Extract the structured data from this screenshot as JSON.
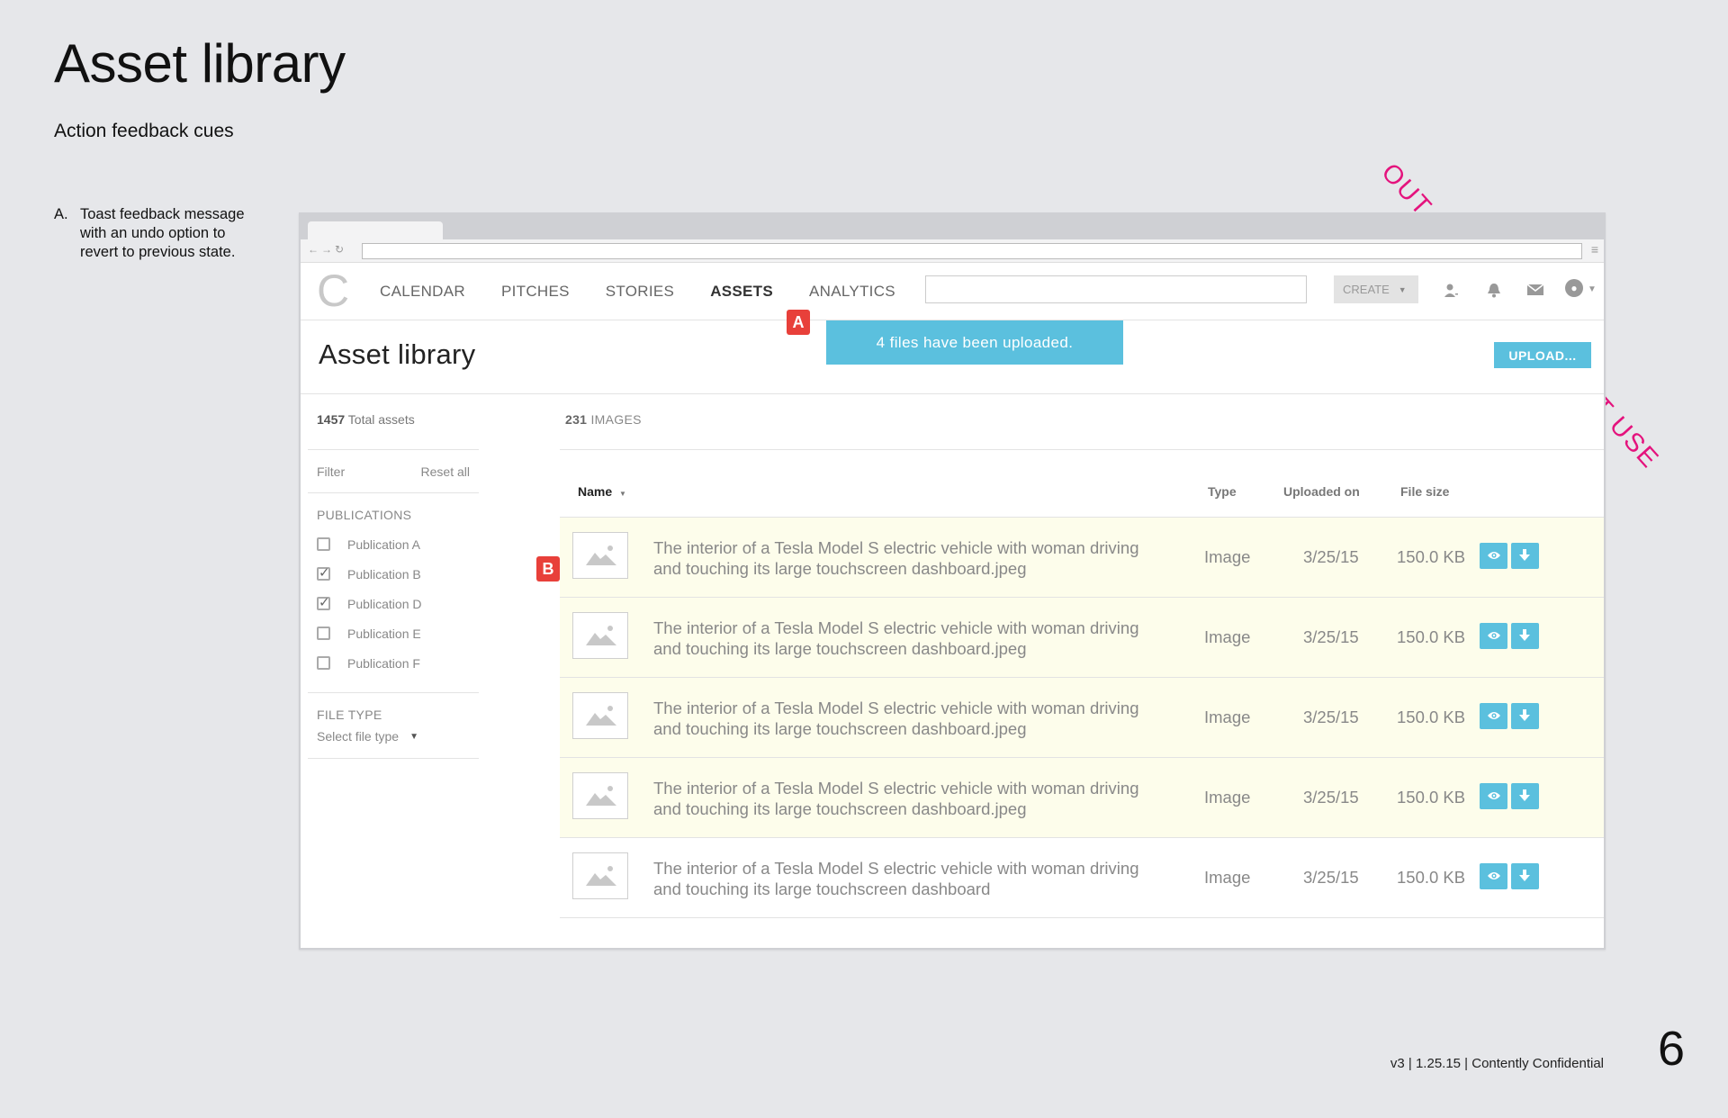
{
  "doc": {
    "title": "Asset library",
    "subtitle": "Action feedback cues",
    "note_marker": "A.",
    "note_text": "Toast feedback message with an undo option to revert to previous state.",
    "stamp": "OUT OF DATE / DO NOT USE",
    "footer": "v3  | 1.25.15  | Contently Confidential",
    "page_number": "6"
  },
  "nav": {
    "logo": "C",
    "items": [
      "CALENDAR",
      "PITCHES",
      "STORIES",
      "ASSETS",
      "ANALYTICS"
    ],
    "active": "ASSETS",
    "create_label": "CREATE"
  },
  "toast": {
    "message": "4 files have been uploaded."
  },
  "callouts": {
    "a": "A",
    "b": "B"
  },
  "page": {
    "title": "Asset library",
    "upload_label": "UPLOAD..."
  },
  "sidebar": {
    "total_count": "1457",
    "total_label": "Total assets",
    "filter_label": "Filter",
    "reset_label": "Reset all",
    "publications_title": "PUBLICATIONS",
    "publications": [
      {
        "label": "Publication A",
        "checked": false
      },
      {
        "label": "Publication B",
        "checked": true
      },
      {
        "label": "Publication D",
        "checked": true
      },
      {
        "label": "Publication E",
        "checked": false
      },
      {
        "label": "Publication F",
        "checked": false
      }
    ],
    "file_type_title": "FILE TYPE",
    "file_type_placeholder": "Select file type"
  },
  "content": {
    "count": "231",
    "count_label": "IMAGES",
    "columns": {
      "name": "Name",
      "type": "Type",
      "uploaded": "Uploaded on",
      "size": "File size"
    },
    "rows": [
      {
        "name": "The interior of a Tesla Model S electric vehicle with woman driving and touching its large touchscreen dashboard.jpeg",
        "type": "Image",
        "date": "3/25/15",
        "size": "150.0 KB",
        "highlighted": true
      },
      {
        "name": "The interior of a Tesla Model S electric vehicle with woman driving and touching its large touchscreen dashboard.jpeg",
        "type": "Image",
        "date": "3/25/15",
        "size": "150.0 KB",
        "highlighted": true
      },
      {
        "name": "The interior of a Tesla Model S electric vehicle with woman driving and touching its large touchscreen dashboard.jpeg",
        "type": "Image",
        "date": "3/25/15",
        "size": "150.0 KB",
        "highlighted": true
      },
      {
        "name": "The interior of a Tesla Model S electric vehicle with woman driving and touching its large touchscreen dashboard.jpeg",
        "type": "Image",
        "date": "3/25/15",
        "size": "150.0 KB",
        "highlighted": true
      },
      {
        "name": "The interior of a Tesla Model S electric vehicle with woman driving and touching its large touchscreen dashboard",
        "type": "Image",
        "date": "3/25/15",
        "size": "150.0 KB",
        "highlighted": false
      }
    ]
  },
  "colors": {
    "accent": "#5bc0de",
    "callout": "#e8403a",
    "highlight_row": "#fdfdeb",
    "stamp": "#e4137d"
  },
  "icons": [
    "image-placeholder-icon",
    "eye-icon",
    "download-icon",
    "user-icon",
    "bell-icon",
    "mail-icon",
    "avatar-icon",
    "chevron-down-icon"
  ]
}
